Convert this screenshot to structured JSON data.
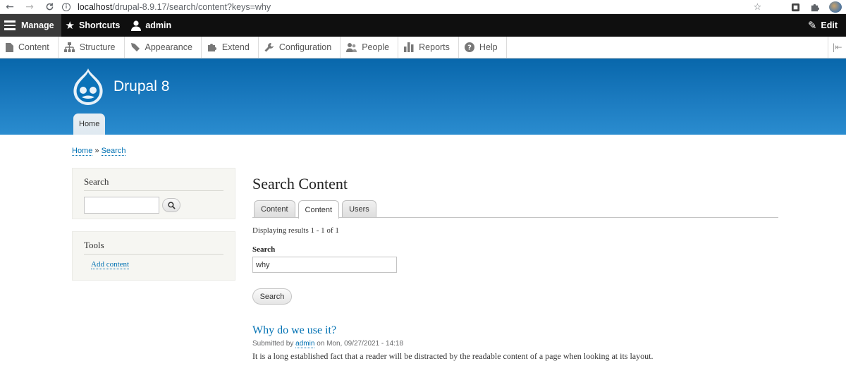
{
  "browser": {
    "back_icon": "arrow-left-icon",
    "forward_icon": "arrow-right-icon",
    "reload_icon": "reload-icon",
    "url_host": "localhost",
    "url_path": "/drupal-8.9.17/search/content?keys=why"
  },
  "toolbar": {
    "manage": "Manage",
    "shortcuts": "Shortcuts",
    "user": "admin",
    "edit": "Edit"
  },
  "tray": {
    "items": [
      {
        "label": "Content",
        "icon": "content-icon"
      },
      {
        "label": "Structure",
        "icon": "structure-icon"
      },
      {
        "label": "Appearance",
        "icon": "appearance-icon"
      },
      {
        "label": "Extend",
        "icon": "extend-icon"
      },
      {
        "label": "Configuration",
        "icon": "wrench-icon"
      },
      {
        "label": "People",
        "icon": "people-icon"
      },
      {
        "label": "Reports",
        "icon": "reports-icon"
      },
      {
        "label": "Help",
        "icon": "help-icon"
      }
    ]
  },
  "header": {
    "site_name": "Drupal 8",
    "home_tab": "Home"
  },
  "breadcrumb": {
    "home": "Home",
    "separator": "»",
    "current": "Search"
  },
  "sidebar": {
    "search_title": "Search",
    "search_value": "",
    "tools_title": "Tools",
    "add_content": "Add content"
  },
  "main": {
    "title": "Search Content",
    "tabs": [
      "Content",
      "Content",
      "Users"
    ],
    "active_tab": 1,
    "results_count": "Displaying results 1 - 1 of 1",
    "search_label": "Search",
    "search_value": "why",
    "submit_label": "Search",
    "result": {
      "title": "Why do we use it?",
      "submitted_by": "Submitted by",
      "author": "admin",
      "date": "on Mon, 09/27/2021 - 14:18",
      "snippet": "It is a long established fact that a reader will be distracted by the readable content of a page when looking at its layout."
    }
  },
  "colors": {
    "toolbar_bg": "#0f0f0f",
    "header_blue": "#0867ab",
    "link": "#0071b3"
  }
}
